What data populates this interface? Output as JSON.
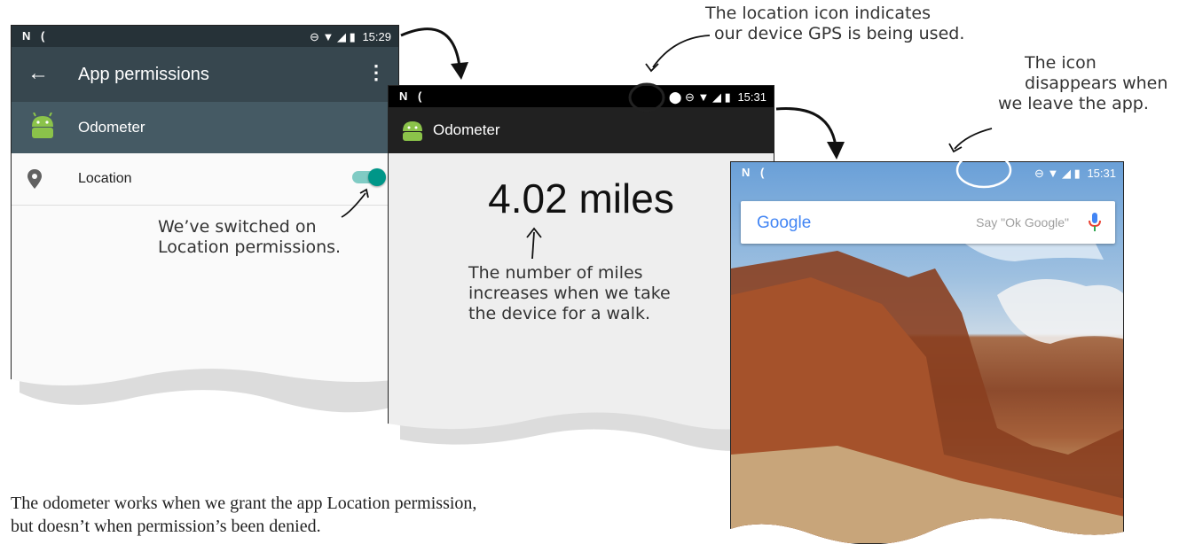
{
  "screen1": {
    "status_left": "N (",
    "status_time": "15:29",
    "title": "App permissions",
    "app_name": "Odometer",
    "permission_label": "Location",
    "toggle_state": "on",
    "colors": {
      "toolbar": "#37474F",
      "appbar": "#455A64",
      "accent": "#009688"
    }
  },
  "screen2": {
    "status_left": "N (",
    "status_time": "15:31",
    "app_title": "Odometer",
    "distance": "4.02 miles",
    "colors": {
      "statusbar": "#000000",
      "appbar": "#212121"
    }
  },
  "screen3": {
    "status_left": "N (",
    "status_time": "15:31",
    "search_logo": "Google",
    "search_hint": "Say \"Ok Google\""
  },
  "annotations": {
    "location_icon_line1": "The location icon indicates",
    "location_icon_line2": "our device GPS is being used.",
    "icon_disappears_line1": "The icon",
    "icon_disappears_line2": "disappears when",
    "icon_disappears_line3": "we leave the app.",
    "switched_on_line1": "We’ve switched on",
    "switched_on_line2": "Location permissions.",
    "miles_line1": "The number of miles",
    "miles_line2": "increases when we take",
    "miles_line3": "the device for a walk."
  },
  "caption": {
    "line1": "The odometer works when we grant the app Location permission,",
    "line2": "but doesn’t when permission’s been denied."
  }
}
